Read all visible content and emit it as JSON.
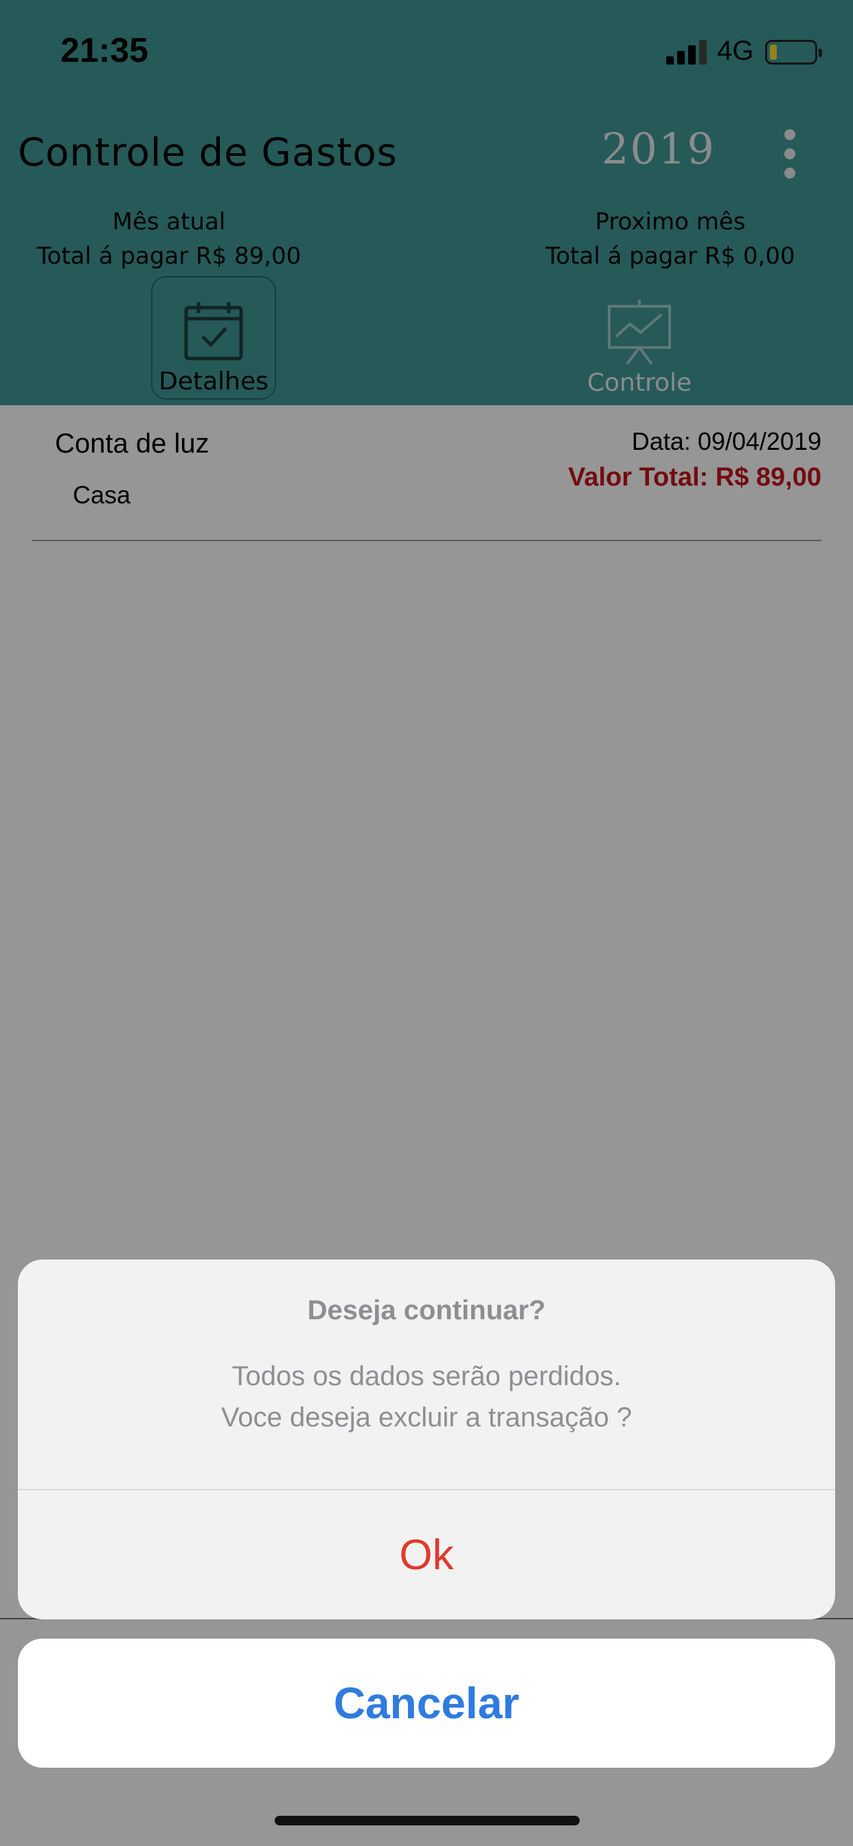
{
  "status_bar": {
    "time": "21:35",
    "network": "4G",
    "battery_level": 0.15,
    "battery_color": "#f2d933"
  },
  "header": {
    "title": "Controle de Gastos",
    "year": "2019",
    "menu_icon": "more-vertical-icon",
    "current_month": {
      "label": "Mês atual",
      "total": "Total á pagar  R$ 89,00"
    },
    "next_month": {
      "label": "Proximo mês",
      "total": "Total á pagar  R$ 0,00"
    },
    "tabs": [
      {
        "label": "Detalhes",
        "icon": "calendar-check-icon",
        "selected": true
      },
      {
        "label": "Controle",
        "icon": "presentation-chart-icon",
        "selected": false
      }
    ],
    "accent_color": "#3f9794"
  },
  "transactions": [
    {
      "name": "Conta de luz",
      "category": "Casa",
      "date": "Data: 09/04/2019",
      "value": "Valor Total: R$ 89,00",
      "value_color": "#c0141a"
    }
  ],
  "action_sheet": {
    "title": "Deseja continuar?",
    "message_line1": "Todos os dados serão perdidos.",
    "message_line2": "Voce deseja excluir a transação ?",
    "ok_label": "Ok",
    "cancel_label": "Cancelar",
    "ok_color": "#e0392c",
    "cancel_color": "#2f7be0"
  }
}
